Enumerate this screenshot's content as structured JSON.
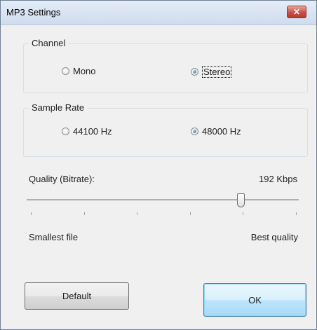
{
  "window": {
    "title": "MP3 Settings",
    "close_glyph": "✕"
  },
  "channel": {
    "label": "Channel",
    "options": [
      {
        "label": "Mono",
        "checked": false
      },
      {
        "label": "Stereo",
        "checked": true
      }
    ]
  },
  "sample_rate": {
    "label": "Sample Rate",
    "options": [
      {
        "label": "44100 Hz",
        "checked": false
      },
      {
        "label": "48000 Hz",
        "checked": true
      }
    ]
  },
  "quality": {
    "label": "Quality (Bitrate):",
    "value": "192 Kbps",
    "min_label": "Smallest file",
    "max_label": "Best quality",
    "level": 0.79
  },
  "buttons": {
    "default_label": "Default",
    "ok_label": "OK"
  }
}
